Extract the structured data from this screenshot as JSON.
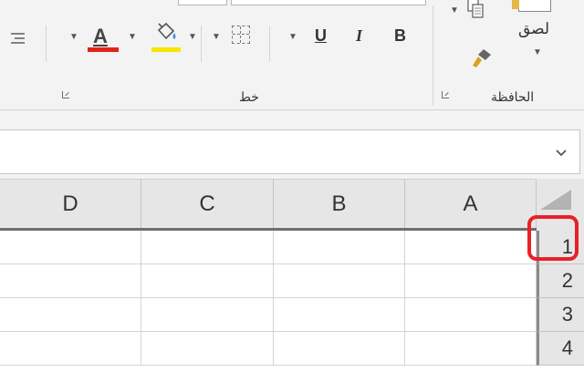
{
  "ribbon": {
    "clipboard_group_label": "الحافظة",
    "paste_label": "لصق",
    "font_group_label": "خط",
    "bold_label": "B",
    "italic_label": "I",
    "underline_label": "U",
    "font_color_letter": "A",
    "font_color": "#e2231a",
    "highlight_color": "#f7e600"
  },
  "formula_bar": {
    "value": "",
    "expand_icon": "chevron-down-icon"
  },
  "grid": {
    "columns": [
      "D",
      "C",
      "B",
      "A"
    ],
    "rows": [
      "1",
      "2",
      "3",
      "4"
    ],
    "highlight_color": "#e8202a"
  }
}
